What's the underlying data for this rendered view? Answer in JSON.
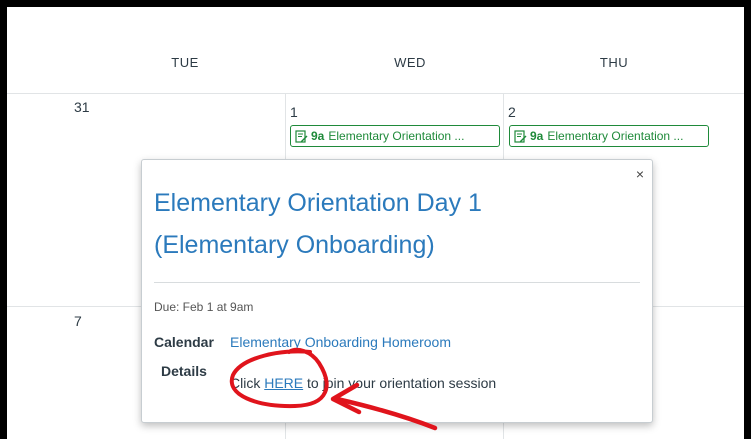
{
  "calendar": {
    "headers": [
      "TUE",
      "WED",
      "THU"
    ],
    "days": {
      "tue": "31",
      "wed": "1",
      "thu": "2",
      "next_tue": "7"
    },
    "events": [
      {
        "time": "9a",
        "title": "Elementary Orientation ..."
      },
      {
        "time": "9a",
        "title": "Elementary Orientation ..."
      }
    ]
  },
  "popover": {
    "close_icon": "×",
    "title_line1": "Elementary Orientation Day 1",
    "title_line2": "(Elementary Onboarding)",
    "due": "Due: Feb 1 at 9am",
    "calendar_label": "Calendar",
    "calendar_value": "Elementary Onboarding Homeroom",
    "details_label": "Details",
    "details_prefix": "Click ",
    "details_link": "HERE",
    "details_suffix": " to join your orientation session"
  },
  "colors": {
    "accent": "#2b7abc",
    "event_green": "#1f8a3a",
    "annotation_red": "#e0141c"
  },
  "icons": {
    "event": "calendar-edit-icon",
    "close": "close-icon"
  }
}
